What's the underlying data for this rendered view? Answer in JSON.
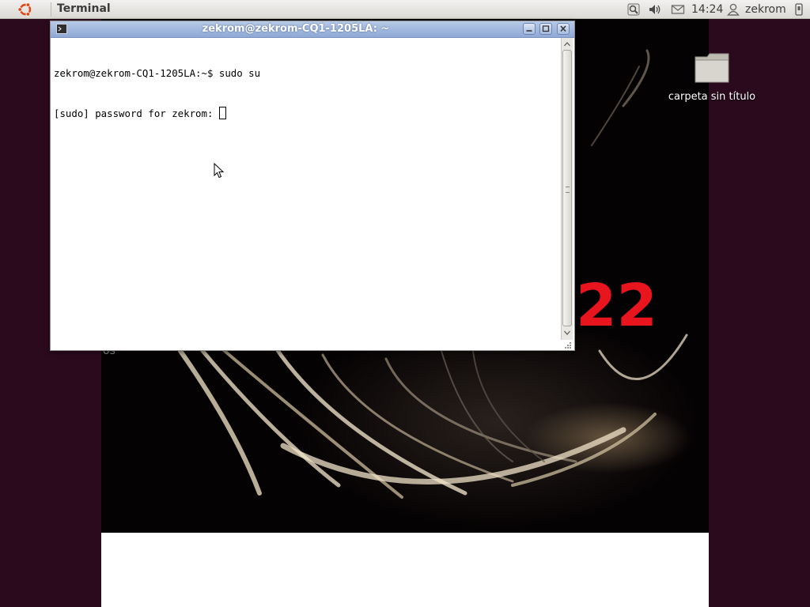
{
  "panel": {
    "app_title": "Terminal",
    "clock": "14:24",
    "username": "zekrom",
    "icons": [
      "ubuntu-logo-icon",
      "network-icon",
      "volume-icon",
      "mail-icon",
      "user-icon",
      "power-icon"
    ]
  },
  "desktop": {
    "folder_label": "carpeta sin título",
    "wallpaper_text": "22",
    "wallpaper_side_text": "os"
  },
  "terminal": {
    "window_title": "zekrom@zekrom-CQ1-1205LA: ~",
    "lines": [
      "zekrom@zekrom-CQ1-1205LA:~$ sudo su",
      "[sudo] password for zekrom: "
    ]
  },
  "colors": {
    "desktop_bg": "#2c0a1e",
    "titlebar": "#9fb6dd",
    "wallpaper_accent": "#e8141e"
  }
}
